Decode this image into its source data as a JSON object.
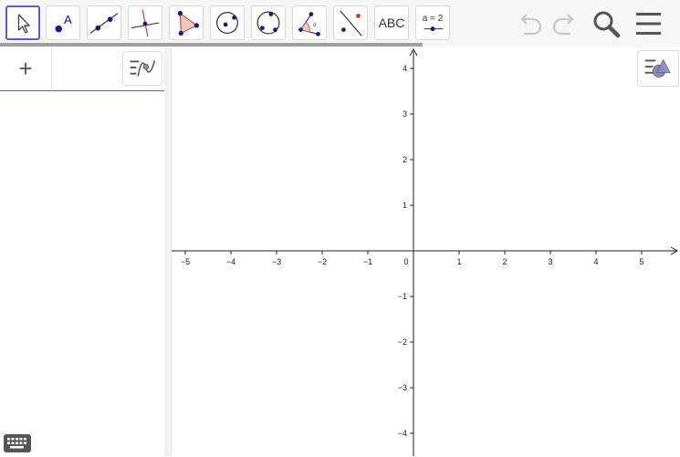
{
  "toolbar": {
    "tools": [
      {
        "name": "move-tool",
        "icon": "arrow-cursor-icon",
        "selected": true
      },
      {
        "name": "point-tool",
        "icon": "point-icon",
        "label": "A"
      },
      {
        "name": "line-tool",
        "icon": "line-through-points-icon"
      },
      {
        "name": "perpendicular-line-tool",
        "icon": "perpendicular-line-icon"
      },
      {
        "name": "polygon-tool",
        "icon": "polygon-icon"
      },
      {
        "name": "circle-center-point-tool",
        "icon": "circle-center-icon"
      },
      {
        "name": "circle-three-points-tool",
        "icon": "circle-three-points-icon"
      },
      {
        "name": "angle-tool",
        "icon": "angle-icon"
      },
      {
        "name": "reflect-about-line-tool",
        "icon": "reflect-icon"
      },
      {
        "name": "text-tool",
        "icon": "text-icon",
        "label": "ABC"
      },
      {
        "name": "slider-tool",
        "icon": "slider-icon",
        "label": "a = 2"
      }
    ],
    "undo": "undo-icon",
    "redo": "redo-icon",
    "search": "search-icon",
    "menu": "menu-icon"
  },
  "algebra": {
    "add_label": "+",
    "style_button": "algebra-style-icon",
    "keyboard": "keyboard-icon"
  },
  "graphics": {
    "x_ticks": [
      "−5",
      "−4",
      "−3",
      "−2",
      "−1",
      "0",
      "1",
      "2",
      "3",
      "4",
      "5"
    ],
    "y_ticks_pos": [
      "1",
      "2",
      "3",
      "4"
    ],
    "y_ticks_neg": [
      "−1",
      "−2",
      "−3",
      "−4"
    ],
    "style_button": "graphics-style-icon"
  },
  "colors": {
    "accent": "#6557d2",
    "point": "#1a1a8c",
    "polygon_fill": "#f5c6c0",
    "red": "#cc3333"
  }
}
